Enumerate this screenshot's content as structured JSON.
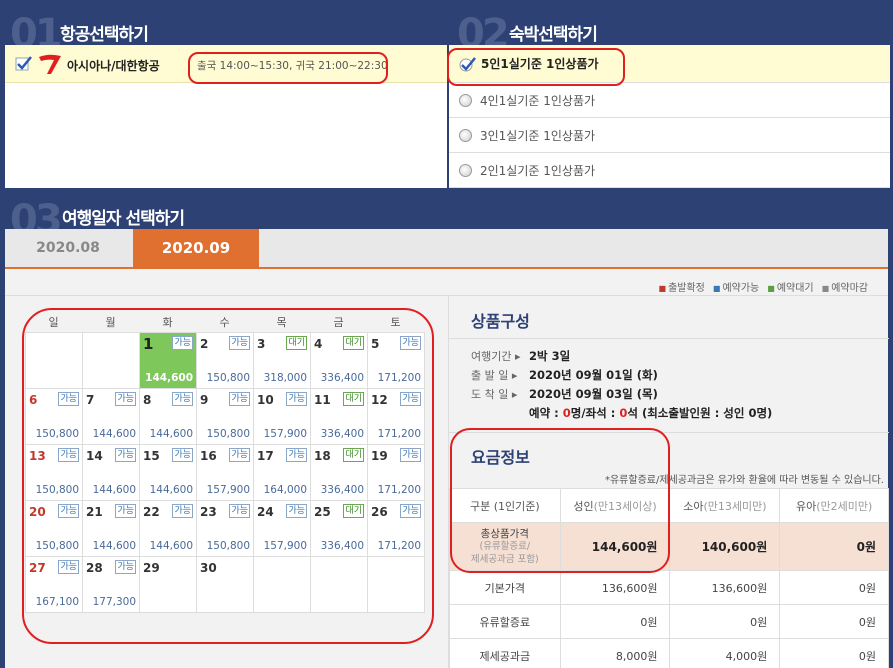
{
  "section1": {
    "number": "01",
    "title": "항공선택하기",
    "airline": "아시아나/대한항공",
    "schedule": "출국 14:00~15:30, 귀국 21:00~22:30"
  },
  "section2": {
    "number": "02",
    "title": "숙박선택하기",
    "options": [
      "5인1실기준 1인상품가",
      "4인1실기준 1인상품가",
      "3인1실기준 1인상품가",
      "2인1실기준 1인상품가"
    ]
  },
  "section3": {
    "number": "03",
    "title": "여행일자 선택하기",
    "tabs": [
      "2020.08",
      "2020.09"
    ],
    "legend": [
      "출발확정",
      "예약가능",
      "예약대기",
      "예약마감"
    ],
    "weekdays": [
      "일",
      "월",
      "화",
      "수",
      "목",
      "금",
      "토"
    ],
    "days": [
      {
        "d": "",
        "s": "",
        "p": ""
      },
      {
        "d": "",
        "s": "",
        "p": ""
      },
      {
        "d": "1",
        "s": "가능",
        "p": "144,600"
      },
      {
        "d": "2",
        "s": "가능",
        "p": "150,800"
      },
      {
        "d": "3",
        "s": "대기",
        "p": "318,000"
      },
      {
        "d": "4",
        "s": "대기",
        "p": "336,400"
      },
      {
        "d": "5",
        "s": "가능",
        "p": "171,200"
      },
      {
        "d": "6",
        "s": "가능",
        "p": "150,800"
      },
      {
        "d": "7",
        "s": "가능",
        "p": "144,600"
      },
      {
        "d": "8",
        "s": "가능",
        "p": "144,600"
      },
      {
        "d": "9",
        "s": "가능",
        "p": "150,800"
      },
      {
        "d": "10",
        "s": "가능",
        "p": "157,900"
      },
      {
        "d": "11",
        "s": "대기",
        "p": "336,400"
      },
      {
        "d": "12",
        "s": "가능",
        "p": "171,200"
      },
      {
        "d": "13",
        "s": "가능",
        "p": "150,800"
      },
      {
        "d": "14",
        "s": "가능",
        "p": "144,600"
      },
      {
        "d": "15",
        "s": "가능",
        "p": "144,600"
      },
      {
        "d": "16",
        "s": "가능",
        "p": "157,900"
      },
      {
        "d": "17",
        "s": "가능",
        "p": "164,000"
      },
      {
        "d": "18",
        "s": "대기",
        "p": "336,400"
      },
      {
        "d": "19",
        "s": "가능",
        "p": "171,200"
      },
      {
        "d": "20",
        "s": "가능",
        "p": "150,800"
      },
      {
        "d": "21",
        "s": "가능",
        "p": "144,600"
      },
      {
        "d": "22",
        "s": "가능",
        "p": "144,600"
      },
      {
        "d": "23",
        "s": "가능",
        "p": "150,800"
      },
      {
        "d": "24",
        "s": "가능",
        "p": "157,900"
      },
      {
        "d": "25",
        "s": "대기",
        "p": "336,400"
      },
      {
        "d": "26",
        "s": "가능",
        "p": "171,200"
      },
      {
        "d": "27",
        "s": "가능",
        "p": "167,100"
      },
      {
        "d": "28",
        "s": "가능",
        "p": "177,300"
      },
      {
        "d": "29",
        "s": "",
        "p": ""
      },
      {
        "d": "30",
        "s": "",
        "p": ""
      },
      {
        "d": "",
        "s": "",
        "p": ""
      },
      {
        "d": "",
        "s": "",
        "p": ""
      },
      {
        "d": "",
        "s": "",
        "p": ""
      }
    ],
    "product": {
      "title": "상품구성",
      "period_k": "여행기간",
      "period_v": "2박 3일",
      "depart_k": "출 발 일",
      "depart_v": "2020년 09월 01일 (화)",
      "arrive_k": "도 착 일",
      "arrive_v": "2020년 09월 03일 (목)",
      "res_label": "예약 :",
      "res_count": "0",
      "res_mid": "명/좌석 :",
      "seat_count": "0",
      "res_tail": "석 (최소출발인원 : 성인 0명)"
    },
    "fare": {
      "title": "요금정보",
      "note": "*유류할증료/제세공과금은 유가와 환율에 따라 변동될 수 있습니다.",
      "h0": "구분 (1인기준)",
      "h1": "성인",
      "h1s": "(만13세이상)",
      "h2": "소아",
      "h2s": "(만13세미만)",
      "h3": "유아",
      "h3s": "(만2세미만)",
      "total_label": "총상품가격",
      "total_sub1": "(유류할증료/",
      "total_sub2": "제세공과금 포함)",
      "total": [
        "144,600원",
        "140,600원",
        "0원"
      ],
      "base_label": "기본가격",
      "base": [
        "136,600원",
        "136,600원",
        "0원"
      ],
      "fuel_label": "유류할증료",
      "fuel": [
        "0원",
        "0원",
        "0원"
      ],
      "tax_label": "제세공과금",
      "tax": [
        "8,000원",
        "4,000원",
        "0원"
      ]
    }
  }
}
